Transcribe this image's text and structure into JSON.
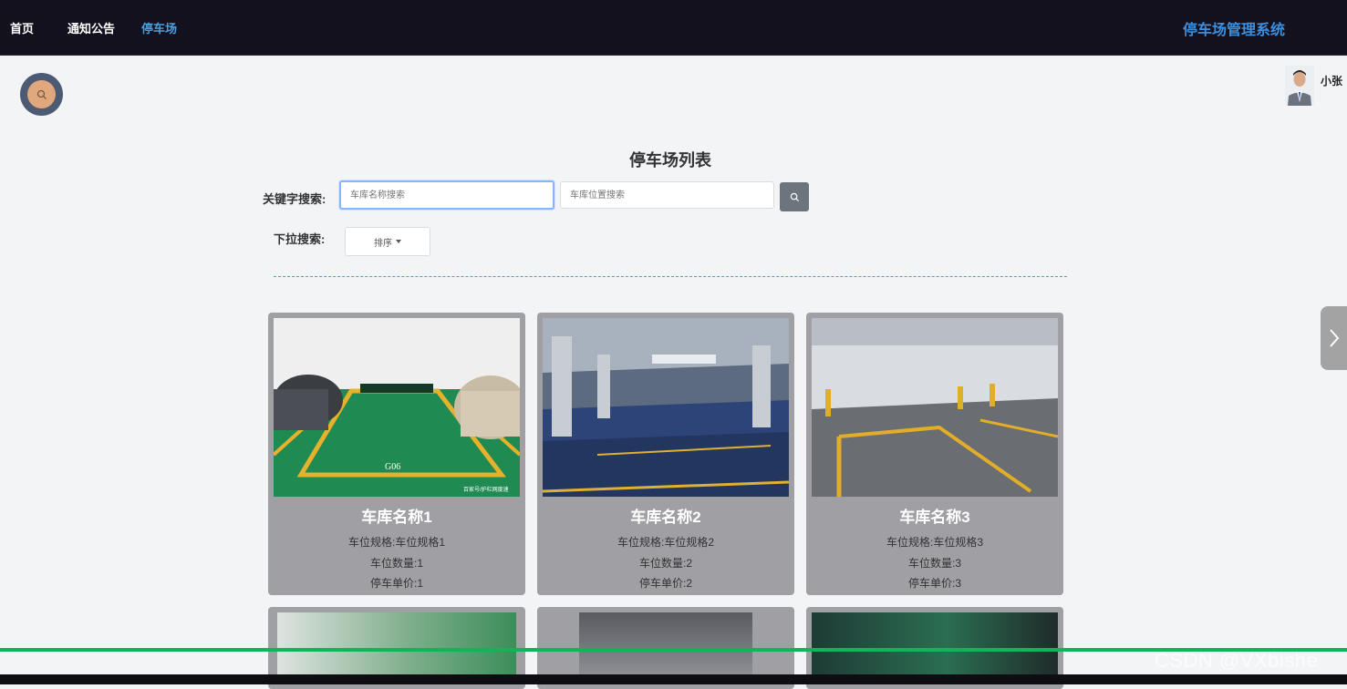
{
  "nav": {
    "items": [
      "首页",
      "通知公告",
      "停车场"
    ],
    "active_index": 2,
    "brand": "停车场管理系统"
  },
  "user": {
    "name": "小张"
  },
  "page": {
    "title": "停车场列表"
  },
  "search": {
    "keyword_label": "关键字搜索:",
    "name_placeholder": "车库名称搜索",
    "location_placeholder": "车库位置搜索",
    "dropdown_label": "下拉搜索:",
    "sort_label": "排序"
  },
  "cards": [
    {
      "name": "车库名称1",
      "spec": "车位规格:车位规格1",
      "count": "车位数量:1",
      "price": "停车单价:1",
      "img_caption": "百家号/护栏网度速"
    },
    {
      "name": "车库名称2",
      "spec": "车位规格:车位规格2",
      "count": "车位数量:2",
      "price": "停车单价:2"
    },
    {
      "name": "车库名称3",
      "spec": "车位规格:车位规格3",
      "count": "车位数量:3",
      "price": "停车单价:3"
    }
  ],
  "watermark": "CSDN @VXbishe",
  "colors": {
    "nav_bg": "#14111f",
    "accent": "#4a9fe0",
    "card_bg": "#a0a0a4",
    "progress": "#16b25a"
  }
}
